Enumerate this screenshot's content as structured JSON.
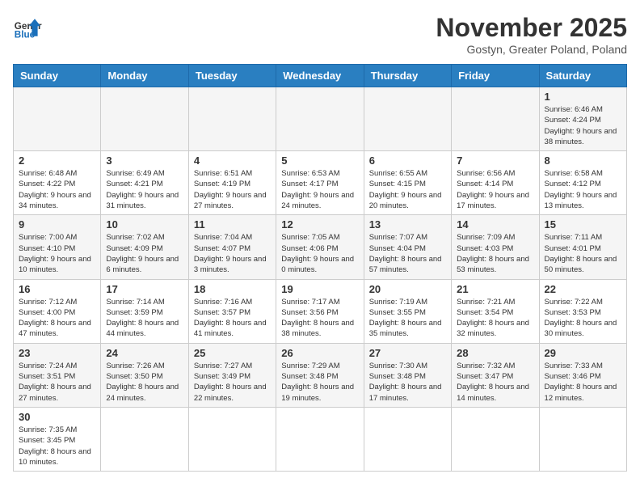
{
  "header": {
    "logo_general": "General",
    "logo_blue": "Blue",
    "month_title": "November 2025",
    "location": "Gostyn, Greater Poland, Poland"
  },
  "weekdays": [
    "Sunday",
    "Monday",
    "Tuesday",
    "Wednesday",
    "Thursday",
    "Friday",
    "Saturday"
  ],
  "weeks": [
    [
      {
        "day": "",
        "info": ""
      },
      {
        "day": "",
        "info": ""
      },
      {
        "day": "",
        "info": ""
      },
      {
        "day": "",
        "info": ""
      },
      {
        "day": "",
        "info": ""
      },
      {
        "day": "",
        "info": ""
      },
      {
        "day": "1",
        "info": "Sunrise: 6:46 AM\nSunset: 4:24 PM\nDaylight: 9 hours and 38 minutes."
      }
    ],
    [
      {
        "day": "2",
        "info": "Sunrise: 6:48 AM\nSunset: 4:22 PM\nDaylight: 9 hours and 34 minutes."
      },
      {
        "day": "3",
        "info": "Sunrise: 6:49 AM\nSunset: 4:21 PM\nDaylight: 9 hours and 31 minutes."
      },
      {
        "day": "4",
        "info": "Sunrise: 6:51 AM\nSunset: 4:19 PM\nDaylight: 9 hours and 27 minutes."
      },
      {
        "day": "5",
        "info": "Sunrise: 6:53 AM\nSunset: 4:17 PM\nDaylight: 9 hours and 24 minutes."
      },
      {
        "day": "6",
        "info": "Sunrise: 6:55 AM\nSunset: 4:15 PM\nDaylight: 9 hours and 20 minutes."
      },
      {
        "day": "7",
        "info": "Sunrise: 6:56 AM\nSunset: 4:14 PM\nDaylight: 9 hours and 17 minutes."
      },
      {
        "day": "8",
        "info": "Sunrise: 6:58 AM\nSunset: 4:12 PM\nDaylight: 9 hours and 13 minutes."
      }
    ],
    [
      {
        "day": "9",
        "info": "Sunrise: 7:00 AM\nSunset: 4:10 PM\nDaylight: 9 hours and 10 minutes."
      },
      {
        "day": "10",
        "info": "Sunrise: 7:02 AM\nSunset: 4:09 PM\nDaylight: 9 hours and 6 minutes."
      },
      {
        "day": "11",
        "info": "Sunrise: 7:04 AM\nSunset: 4:07 PM\nDaylight: 9 hours and 3 minutes."
      },
      {
        "day": "12",
        "info": "Sunrise: 7:05 AM\nSunset: 4:06 PM\nDaylight: 9 hours and 0 minutes."
      },
      {
        "day": "13",
        "info": "Sunrise: 7:07 AM\nSunset: 4:04 PM\nDaylight: 8 hours and 57 minutes."
      },
      {
        "day": "14",
        "info": "Sunrise: 7:09 AM\nSunset: 4:03 PM\nDaylight: 8 hours and 53 minutes."
      },
      {
        "day": "15",
        "info": "Sunrise: 7:11 AM\nSunset: 4:01 PM\nDaylight: 8 hours and 50 minutes."
      }
    ],
    [
      {
        "day": "16",
        "info": "Sunrise: 7:12 AM\nSunset: 4:00 PM\nDaylight: 8 hours and 47 minutes."
      },
      {
        "day": "17",
        "info": "Sunrise: 7:14 AM\nSunset: 3:59 PM\nDaylight: 8 hours and 44 minutes."
      },
      {
        "day": "18",
        "info": "Sunrise: 7:16 AM\nSunset: 3:57 PM\nDaylight: 8 hours and 41 minutes."
      },
      {
        "day": "19",
        "info": "Sunrise: 7:17 AM\nSunset: 3:56 PM\nDaylight: 8 hours and 38 minutes."
      },
      {
        "day": "20",
        "info": "Sunrise: 7:19 AM\nSunset: 3:55 PM\nDaylight: 8 hours and 35 minutes."
      },
      {
        "day": "21",
        "info": "Sunrise: 7:21 AM\nSunset: 3:54 PM\nDaylight: 8 hours and 32 minutes."
      },
      {
        "day": "22",
        "info": "Sunrise: 7:22 AM\nSunset: 3:53 PM\nDaylight: 8 hours and 30 minutes."
      }
    ],
    [
      {
        "day": "23",
        "info": "Sunrise: 7:24 AM\nSunset: 3:51 PM\nDaylight: 8 hours and 27 minutes."
      },
      {
        "day": "24",
        "info": "Sunrise: 7:26 AM\nSunset: 3:50 PM\nDaylight: 8 hours and 24 minutes."
      },
      {
        "day": "25",
        "info": "Sunrise: 7:27 AM\nSunset: 3:49 PM\nDaylight: 8 hours and 22 minutes."
      },
      {
        "day": "26",
        "info": "Sunrise: 7:29 AM\nSunset: 3:48 PM\nDaylight: 8 hours and 19 minutes."
      },
      {
        "day": "27",
        "info": "Sunrise: 7:30 AM\nSunset: 3:48 PM\nDaylight: 8 hours and 17 minutes."
      },
      {
        "day": "28",
        "info": "Sunrise: 7:32 AM\nSunset: 3:47 PM\nDaylight: 8 hours and 14 minutes."
      },
      {
        "day": "29",
        "info": "Sunrise: 7:33 AM\nSunset: 3:46 PM\nDaylight: 8 hours and 12 minutes."
      }
    ],
    [
      {
        "day": "30",
        "info": "Sunrise: 7:35 AM\nSunset: 3:45 PM\nDaylight: 8 hours and 10 minutes."
      },
      {
        "day": "",
        "info": ""
      },
      {
        "day": "",
        "info": ""
      },
      {
        "day": "",
        "info": ""
      },
      {
        "day": "",
        "info": ""
      },
      {
        "day": "",
        "info": ""
      },
      {
        "day": "",
        "info": ""
      }
    ]
  ]
}
